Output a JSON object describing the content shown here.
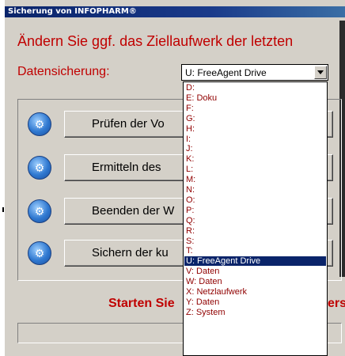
{
  "window": {
    "title": "Sicherung von INFOPHARM®"
  },
  "headline": "Ändern Sie ggf. das Ziellaufwerk der letzten",
  "backup": {
    "label": "Datensicherung:",
    "selected": "U:  FreeAgent Drive"
  },
  "steps": [
    {
      "label": "Prüfen der Vo"
    },
    {
      "label": "Ermitteln des"
    },
    {
      "label": "Beenden der W"
    },
    {
      "label": "Sichern der ku"
    }
  ],
  "start": {
    "left": "Starten Sie",
    "right": "ers"
  },
  "dropdown": {
    "options": [
      "D:",
      "E:  Doku",
      "F:",
      "G:",
      "H:",
      "I:",
      "J:",
      "K:",
      "L:",
      "M:",
      "N:",
      "O:",
      "P:",
      "Q:",
      "R:",
      "S:",
      "T:",
      "U:  FreeAgent Drive",
      "V:  Daten",
      "W:  Daten",
      "X:  Netzlaufwerk",
      "Y:  Daten",
      "Z:  System"
    ],
    "selected_index": 17
  },
  "colors": {
    "titlebar": "#0a246a",
    "accent_red": "#c00000",
    "dialog_bg": "#d4d0c8",
    "highlight": "#0a246a"
  },
  "icons": {
    "step": "gear-icon",
    "dropdown": "chevron-down-icon"
  }
}
